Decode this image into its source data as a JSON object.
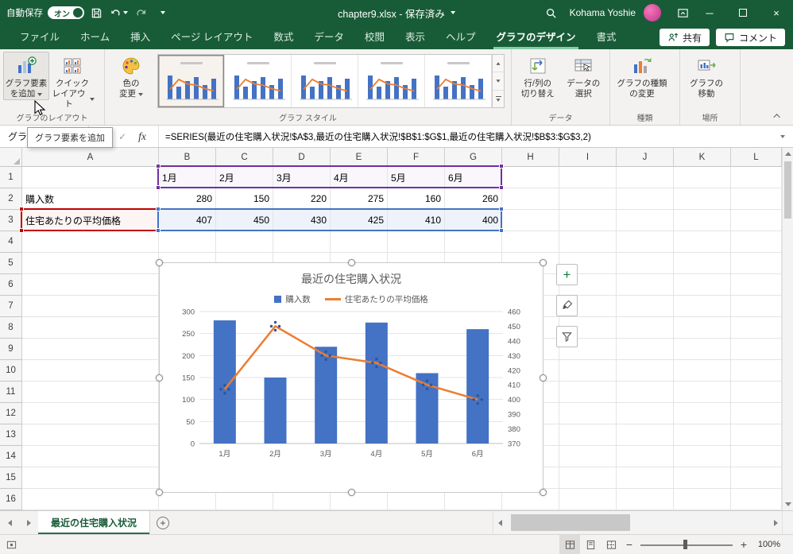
{
  "titlebar": {
    "autosave_label": "自動保存",
    "autosave_state": "オン",
    "filename": "chapter9.xlsx - 保存済み",
    "user_name": "Kohama Yoshie"
  },
  "tabs": [
    {
      "label": "ファイル",
      "active": false
    },
    {
      "label": "ホーム",
      "active": false
    },
    {
      "label": "挿入",
      "active": false
    },
    {
      "label": "ページ レイアウト",
      "active": false
    },
    {
      "label": "数式",
      "active": false
    },
    {
      "label": "データ",
      "active": false
    },
    {
      "label": "校閲",
      "active": false
    },
    {
      "label": "表示",
      "active": false
    },
    {
      "label": "ヘルプ",
      "active": false
    },
    {
      "label": "グラフのデザイン",
      "active": true
    },
    {
      "label": "書式",
      "active": false
    }
  ],
  "actions": {
    "share": "共有",
    "comments": "コメント"
  },
  "ribbon": {
    "add_element_l1": "グラフ要素",
    "add_element_l2": "を追加",
    "quick_layout_l1": "クイック",
    "quick_layout_l2": "レイアウト",
    "change_colors_l1": "色の",
    "change_colors_l2": "変更",
    "switch_l1": "行/列の",
    "switch_l2": "切り替え",
    "select_data_l1": "データの",
    "select_data_l2": "選択",
    "change_type_l1": "グラフの種類",
    "change_type_l2": "の変更",
    "move_chart_l1": "グラフの",
    "move_chart_l2": "移動",
    "groups": {
      "layout": "グラフのレイアウト",
      "styles": "グラフ スタイル",
      "data": "データ",
      "type": "種類",
      "location": "場所"
    }
  },
  "tooltip": "グラフ要素を追加",
  "formula_bar": {
    "name_box": "グラフ 1",
    "formula": "=SERIES(最近の住宅購入状況!$A$3,最近の住宅購入状況!$B$1:$G$1,最近の住宅購入状況!$B$3:$G$3,2)"
  },
  "grid": {
    "column_headers": [
      "A",
      "B",
      "C",
      "D",
      "E",
      "F",
      "G",
      "H",
      "I",
      "J",
      "K",
      "L"
    ],
    "row_count": 16,
    "row1_months": [
      "1月",
      "2月",
      "3月",
      "4月",
      "5月",
      "6月"
    ],
    "row2_label": "購入数",
    "row2_values": [
      "280",
      "150",
      "220",
      "275",
      "160",
      "260"
    ],
    "row3_label": "住宅あたりの平均価格",
    "row3_values": [
      "407",
      "450",
      "430",
      "425",
      "410",
      "400"
    ]
  },
  "chart_data": {
    "type": "combo",
    "title": "最近の住宅購入状況",
    "categories": [
      "1月",
      "2月",
      "3月",
      "4月",
      "5月",
      "6月"
    ],
    "series": [
      {
        "name": "購入数",
        "type": "bar",
        "axis": "left",
        "color": "#4472C4",
        "values": [
          280,
          150,
          220,
          275,
          160,
          260
        ]
      },
      {
        "name": "住宅あたりの平均価格",
        "type": "line",
        "axis": "right",
        "color": "#ED7D31",
        "values": [
          407,
          450,
          430,
          425,
          410,
          400
        ],
        "selected": true
      }
    ],
    "left_axis": {
      "min": 0,
      "max": 300,
      "step": 50
    },
    "right_axis": {
      "min": 370,
      "max": 460,
      "step": 10
    },
    "legend_position": "top",
    "gridlines": true
  },
  "sheet_tabs": {
    "active_tab": "最近の住宅購入状況"
  },
  "status_bar": {
    "zoom_label": "100%"
  }
}
